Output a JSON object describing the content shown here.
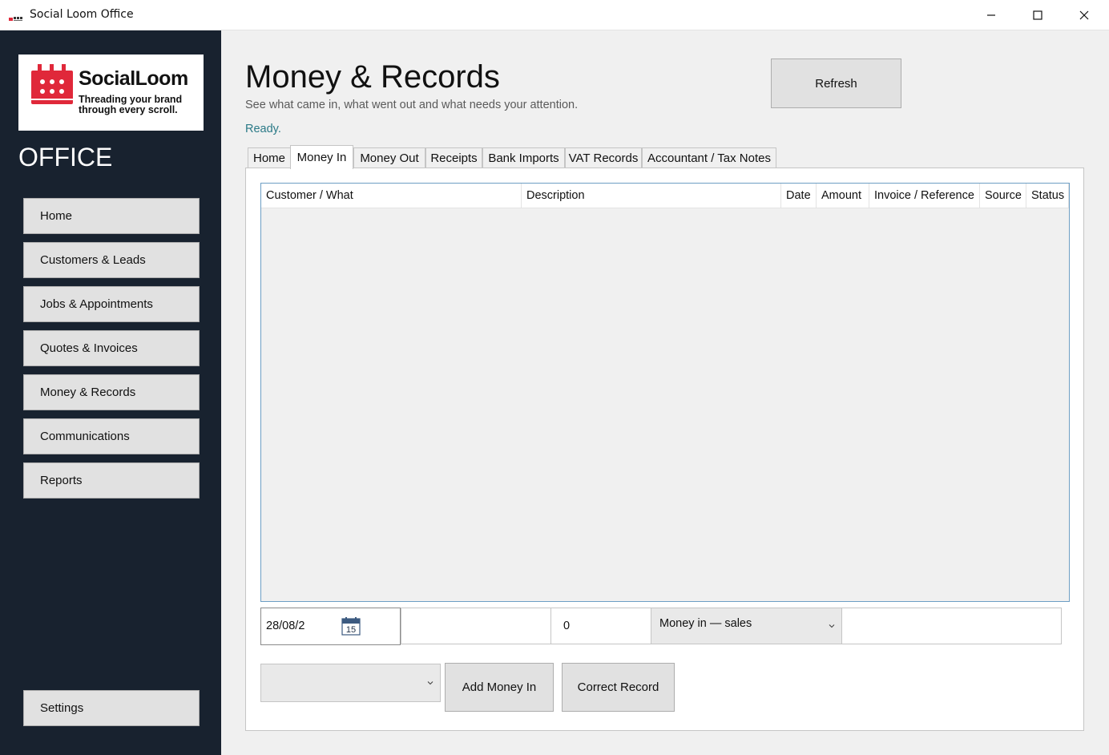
{
  "window": {
    "title": "Social Loom Office"
  },
  "sidebar": {
    "logo": {
      "name": "SocialLoom",
      "tagline": "Threading your brand through every scroll."
    },
    "section_label": "OFFICE",
    "items": [
      {
        "label": "Home"
      },
      {
        "label": "Customers & Leads"
      },
      {
        "label": "Jobs & Appointments"
      },
      {
        "label": "Quotes & Invoices"
      },
      {
        "label": "Money & Records"
      },
      {
        "label": "Communications"
      },
      {
        "label": "Reports"
      }
    ],
    "settings_label": "Settings"
  },
  "header": {
    "title": "Money & Records",
    "subtitle": "See what came in, what went out and what needs your attention.",
    "status": "Ready.",
    "refresh_label": "Refresh"
  },
  "tabs": [
    {
      "label": "Home",
      "active": false
    },
    {
      "label": "Money In",
      "active": true
    },
    {
      "label": "Money Out",
      "active": false
    },
    {
      "label": "Receipts",
      "active": false
    },
    {
      "label": "Bank Imports",
      "active": false
    },
    {
      "label": "VAT Records",
      "active": false
    },
    {
      "label": "Accountant / Tax Notes",
      "active": false
    }
  ],
  "grid": {
    "columns": [
      "Customer / What",
      "Description",
      "Date",
      "Amount",
      "Invoice / Reference",
      "Source",
      "Status"
    ],
    "rows": []
  },
  "entry": {
    "date_value": "28/08/2",
    "calendar_day": "15",
    "description_value": "",
    "amount_value": "0",
    "category_value": "Money in — sales",
    "reference_value": "",
    "customer_value": "",
    "add_label": "Add Money In",
    "correct_label": "Correct Record"
  },
  "colors": {
    "sidebar_bg": "#18222f",
    "logo_red": "#e0283a",
    "status_teal": "#2b7a87",
    "grid_border": "#6d9ec4"
  }
}
